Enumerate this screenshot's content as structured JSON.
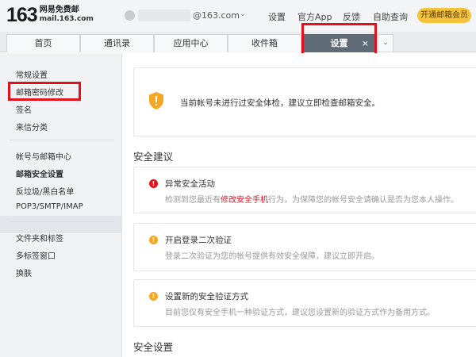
{
  "header": {
    "logo_number": "163",
    "logo_name": "网易免费邮",
    "logo_domain": "mail.163.com",
    "email_domain": "@163.com",
    "email_caret": "⌄",
    "links": [
      "设置",
      "官方App",
      "反馈",
      "自助查询"
    ],
    "vip_button": "开通邮箱会员"
  },
  "tabs": {
    "items": [
      "首页",
      "通讯录",
      "应用中心",
      "收件箱",
      "设置"
    ],
    "active": "设置",
    "close_glyph": "×",
    "more_glyph": "⌄"
  },
  "sidebar": {
    "group1": [
      "常规设置",
      "邮箱密码修改",
      "签名",
      "来信分类"
    ],
    "group2": [
      "帐号与邮箱中心",
      "邮箱安全设置",
      "反垃圾/黑白名单",
      "POP3/SMTP/IMAP"
    ],
    "group3": [
      "文件夹和标签",
      "多标签窗口",
      "换肤"
    ],
    "active_item": "邮箱安全设置"
  },
  "main": {
    "notice": "当前帐号未进行过安全体检，建议立即检查邮箱安全。",
    "section1_title": "安全建议",
    "alerts": [
      {
        "title": "异常安全活动",
        "desc_before": "检测到您最近有",
        "desc_link": "修改安全手机",
        "desc_after": "行为，为保障您的帐号安全请确认是否为您本人操作。",
        "level": "danger",
        "glyph": "!"
      },
      {
        "title": "开启登录二次验证",
        "desc_before": "登录二次验证为您的帐号提供有效安全保障，建议立即开启。",
        "level": "warning",
        "glyph": "!"
      },
      {
        "title": "设置新的安全验证方式",
        "desc_before": "目前您仅有安全手机一种验证方式，建议您设置新的验证方式作为备用方式。",
        "level": "warning",
        "glyph": "!"
      }
    ],
    "section2_title": "安全设置"
  },
  "colors": {
    "danger": "#e0121b",
    "warning": "#f5a623",
    "active_tab": "#5f6b77",
    "vip": "#f5c33b",
    "highlight_box": "#e0121b"
  },
  "icons": {
    "notice_icon": "shield-warning-icon",
    "alert_icon": "exclamation-circle-icon"
  }
}
